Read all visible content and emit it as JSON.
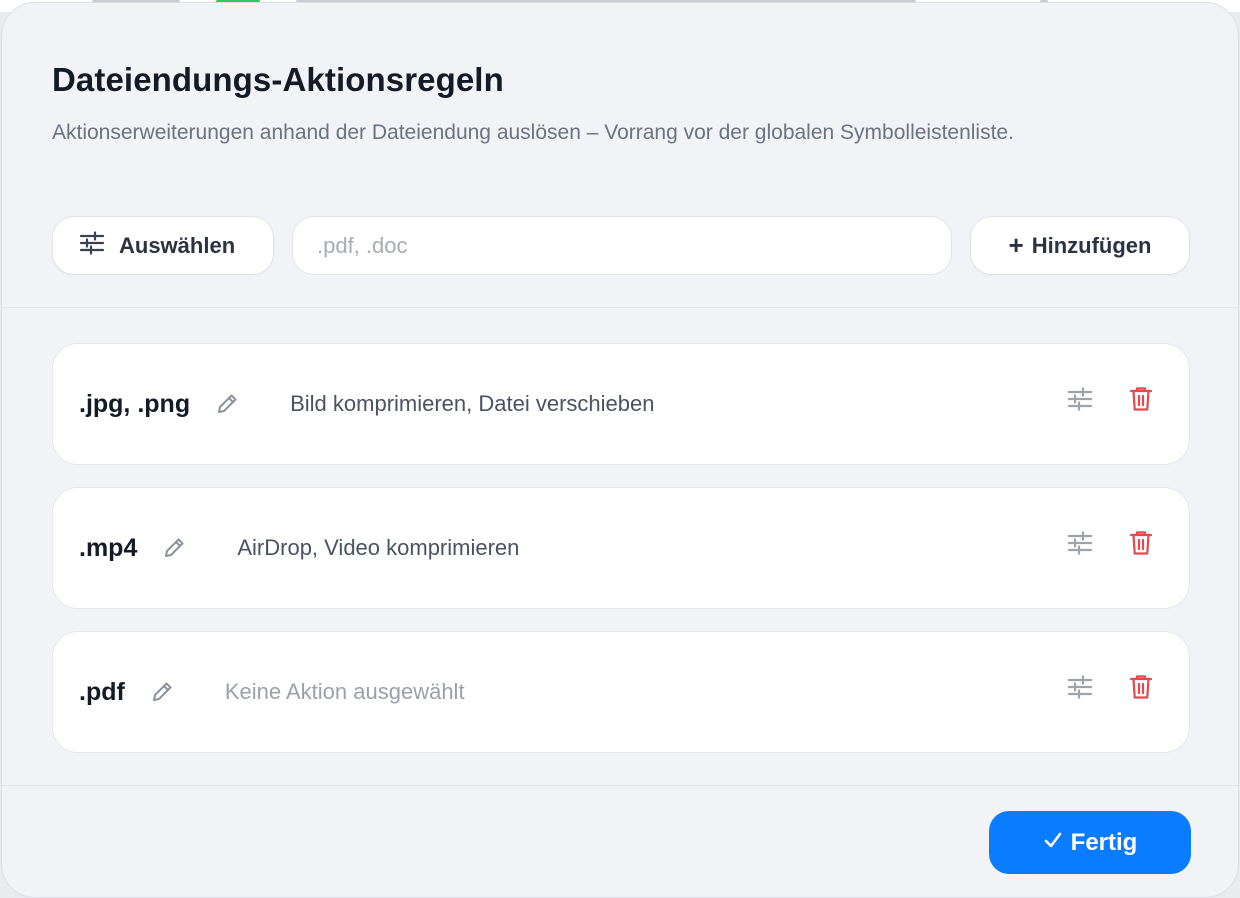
{
  "dialog": {
    "title": "Dateiendungs-Aktionsregeln",
    "subtitle": "Aktionserweiterungen anhand der Dateiendung auslösen – Vorrang vor der globalen Symbolleistenliste."
  },
  "toolbar": {
    "select_label": "Auswählen",
    "extension_placeholder": ".pdf, .doc",
    "extension_value": "",
    "add_label": "Hinzufügen",
    "add_icon": "plus-icon",
    "select_icon": "sliders-icon"
  },
  "rules": [
    {
      "extensions": ".jpg, .png",
      "actions": "Bild komprimieren, Datei verschieben",
      "empty": false
    },
    {
      "extensions": ".mp4",
      "actions": "AirDrop, Video komprimieren",
      "empty": false
    },
    {
      "extensions": ".pdf",
      "actions": "Keine Aktion ausgewählt",
      "empty": true
    }
  ],
  "footer": {
    "done_label": "Fertig",
    "done_icon": "checkmark-icon"
  },
  "colors": {
    "accent": "#0a7cff",
    "delete": "#e5484d",
    "background": "#f2f3f6"
  }
}
